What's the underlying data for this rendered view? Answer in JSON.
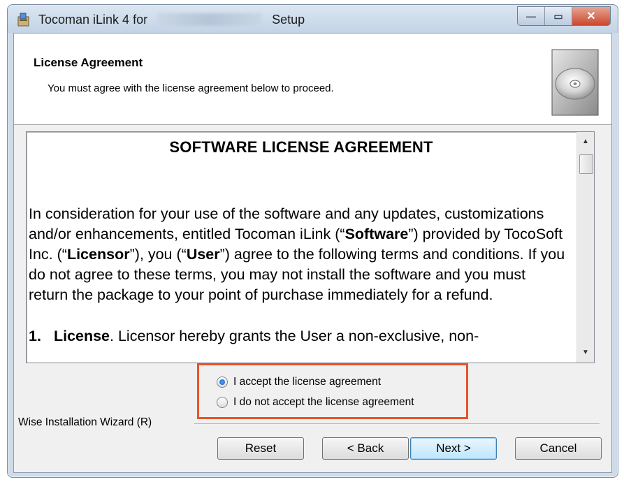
{
  "window": {
    "title_prefix": "Tocoman iLink 4 for",
    "title_suffix": "Setup",
    "controls": {
      "minimize": "—",
      "maximize": "▭",
      "close": "✕"
    }
  },
  "header": {
    "title": "License Agreement",
    "subtitle": "You must agree with the license agreement below to proceed."
  },
  "license": {
    "heading": "SOFTWARE LICENSE AGREEMENT",
    "para_1": "In consideration for your use of the software and any updates, customizations and/or enhancements, entitled Tocoman iLink (“",
    "para_bold_1": "Software",
    "para_2": "”) provided by TocoSoft Inc. (“",
    "para_bold_2": "Licensor",
    "para_3": "”), you (“",
    "para_bold_3": "User",
    "para_4": "”) agree to the following terms and conditions.  If you do not agree to these terms, you may not install the software and you must return the package to your point of purchase immediately for a refund.",
    "clause_number": "1.",
    "clause_title": "License",
    "clause_text": ".  Licensor hereby grants the User a non-exclusive, non-"
  },
  "options": {
    "accept": "I accept the license agreement",
    "decline": "I do not accept the license agreement",
    "selected": "accept"
  },
  "footer": {
    "wizard_label": "Wise Installation Wizard (R)"
  },
  "buttons": {
    "reset": "Reset",
    "back": "< Back",
    "next": "Next >",
    "cancel": "Cancel"
  },
  "colors": {
    "highlight": "#e8542b",
    "radio_selected": "#1663b8"
  }
}
